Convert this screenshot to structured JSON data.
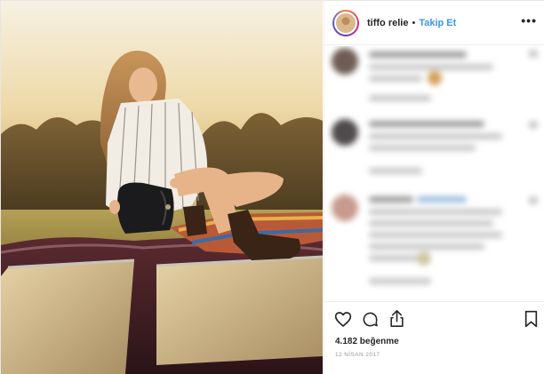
{
  "header": {
    "username": "tiffo relie",
    "separator": "•",
    "follow_label": "Takip Et",
    "more_glyph": "•••"
  },
  "actions": {
    "like_icon": "heart-icon",
    "comment_icon": "comment-icon",
    "share_icon": "share-icon",
    "save_icon": "bookmark-icon"
  },
  "likes_text": "4.182 beğenme",
  "date_text": "12 NİSAN 2017",
  "colors": {
    "follow_blue": "#3897f0",
    "text_dark": "#262626",
    "text_muted": "#999999"
  }
}
